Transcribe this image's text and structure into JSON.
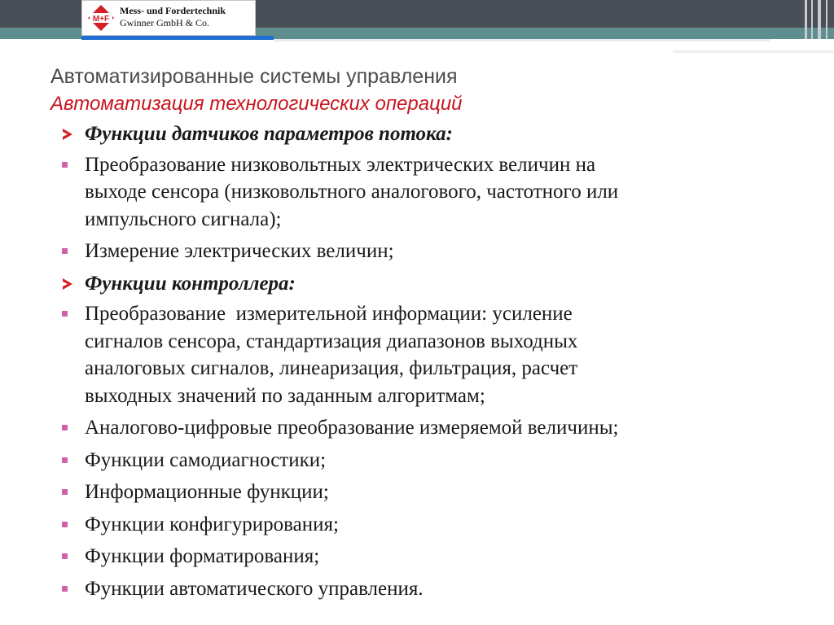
{
  "header": {
    "logo_mark": "M+F",
    "company_line1": "Mess- und Fordertechnik",
    "company_line2": "Gwinner GmbH & Co.",
    "colors": {
      "band": "#4a4e57",
      "teal": "#5f8e8f",
      "logo_red": "#d32027",
      "accent_blue": "#1f6ed4"
    }
  },
  "slide": {
    "title": "Автоматизированные системы управления",
    "subtitle": "Автоматизация технологических операций",
    "subtitle_color": "#c9151e",
    "bullet_color": "#d061a7",
    "arrow_color": "#d32027",
    "items": [
      {
        "type": "head",
        "marker": "arrow-icon",
        "text": "Функции датчиков параметров потока:"
      },
      {
        "type": "sub",
        "marker": "square-bullet-icon",
        "lines": [
          "Преобразование низковольтных электрических величин на",
          "выходе сенсора (низковольтного аналогового, частотного или",
          "импульсного сигнала);"
        ]
      },
      {
        "type": "sub",
        "marker": "square-bullet-icon",
        "lines": [
          "Измерение электрических величин;"
        ]
      },
      {
        "type": "head",
        "marker": "arrow-icon",
        "text": "Функции контроллера:"
      },
      {
        "type": "sub",
        "marker": "square-bullet-icon",
        "lines": [
          "Преобразование  измерительной информации: усиление",
          "сигналов сенсора, стандартизация диапазонов выходных",
          "аналоговых сигналов, линеаризация, фильтрация, расчет",
          "выходных значений по заданным алгоритмам;"
        ]
      },
      {
        "type": "sub",
        "marker": "square-bullet-icon",
        "lines": [
          "Аналогово-цифровые преобразование измеряемой величины;"
        ]
      },
      {
        "type": "sub",
        "marker": "square-bullet-icon",
        "lines": [
          "Функции самодиагностики;"
        ]
      },
      {
        "type": "sub",
        "marker": "square-bullet-icon",
        "lines": [
          "Информационные функции;"
        ]
      },
      {
        "type": "sub",
        "marker": "square-bullet-icon",
        "lines": [
          "Функции конфигурирования;"
        ]
      },
      {
        "type": "sub",
        "marker": "square-bullet-icon",
        "lines": [
          "Функции форматирования;"
        ]
      },
      {
        "type": "sub",
        "marker": "square-bullet-icon",
        "lines": [
          "Функции автоматического управления."
        ]
      }
    ]
  }
}
